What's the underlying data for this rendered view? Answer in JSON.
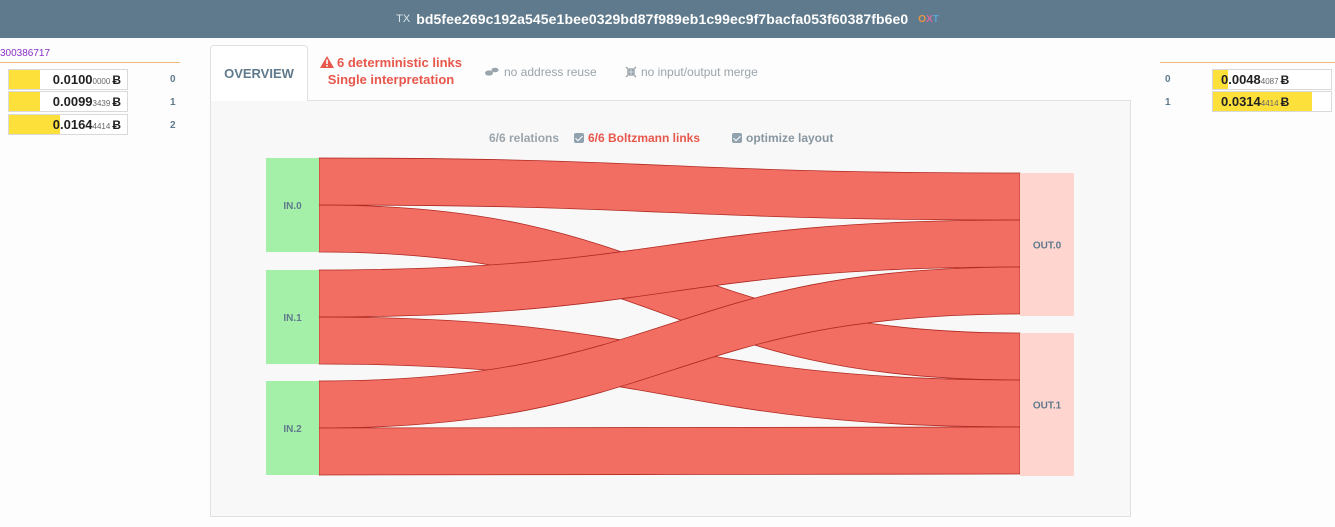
{
  "header": {
    "prefix": "TX",
    "txid": "bd5fee269c192a545e1bee0329bd87f989eb1c99ec9f7bacfa053f60387fb6e0",
    "oxt_o": "O",
    "oxt_x": "X",
    "oxt_t": "T"
  },
  "inputs": {
    "address_fragment": "300386717",
    "items": [
      {
        "index": "0",
        "amount_main": "0.0100",
        "amount_small": "0000",
        "unit": "Ƀ",
        "fill_fraction": 0.26
      },
      {
        "index": "1",
        "amount_main": "0.0099",
        "amount_small": "3439",
        "unit": "Ƀ",
        "fill_fraction": 0.26
      },
      {
        "index": "2",
        "amount_main": "0.0164",
        "amount_small": "4414",
        "unit": "Ƀ",
        "fill_fraction": 0.43
      }
    ]
  },
  "outputs": {
    "items": [
      {
        "index": "0",
        "amount_main": "0.0048",
        "amount_small": "4087",
        "unit": "Ƀ",
        "fill_fraction": 0.13
      },
      {
        "index": "1",
        "amount_main": "0.0314",
        "amount_small": "4414",
        "unit": "Ƀ",
        "fill_fraction": 0.84
      }
    ]
  },
  "tabs": {
    "overview": "OVERVIEW",
    "deterministic_line1": "6 deterministic links",
    "deterministic_line2": "Single interpretation",
    "address_reuse": "no address reuse",
    "io_merge": "no input/output merge"
  },
  "options": {
    "relations": "6/6 relations",
    "boltzmann": "6/6 Boltzmann links",
    "optimize": "optimize layout"
  },
  "diagram": {
    "nodes_in": [
      "IN.0",
      "IN.1",
      "IN.2"
    ],
    "nodes_out": [
      "OUT.0",
      "OUT.1"
    ],
    "links": [
      {
        "from": 0,
        "to": 0
      },
      {
        "from": 0,
        "to": 1
      },
      {
        "from": 1,
        "to": 0
      },
      {
        "from": 1,
        "to": 1
      },
      {
        "from": 2,
        "to": 0
      },
      {
        "from": 2,
        "to": 1
      }
    ]
  },
  "colors": {
    "header_bg": "#5f7a8c",
    "link": "#f26d62",
    "link_stroke": "#b02a22",
    "in_node": "#a5f0a9",
    "out_node": "#ffd5cf",
    "amount_fill": "#fde03a",
    "deterministic": "#e8574c"
  }
}
